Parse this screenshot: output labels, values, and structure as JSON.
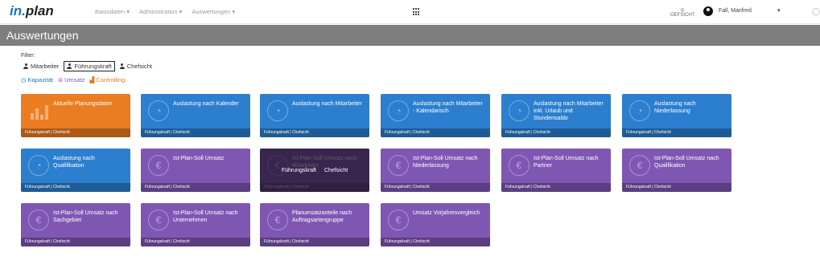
{
  "app": {
    "logo_part1": "in.",
    "logo_part2": "plan"
  },
  "nav": [
    "Basisdaten ▾",
    "Administration ▾",
    "Auswertungen ▾"
  ],
  "brand": {
    "line1": "◎",
    "line2": "OEFSICHT"
  },
  "user": {
    "name": "Fall, Manfred",
    "caret": "▾"
  },
  "page": {
    "title": "Auswertungen"
  },
  "filter": {
    "label": "Filter:",
    "roles": [
      {
        "label": "Mitarbeiter",
        "active": false
      },
      {
        "label": "Führungskraft",
        "active": true
      },
      {
        "label": "Chefsicht",
        "active": false
      }
    ],
    "categories": [
      {
        "label": "Kapazität",
        "icon": "clock-icon",
        "color": "#1a73c8"
      },
      {
        "label": "Umsatz",
        "icon": "euro-icon",
        "color": "#8b4fb3"
      },
      {
        "label": "Controlling",
        "icon": "bar-chart-icon",
        "color": "#e07b20"
      }
    ]
  },
  "tiles": [
    {
      "title": "Aktuelle Planungsdaten",
      "color": "orange",
      "icon": "bar-chart-icon",
      "footer": "Führungskraft | Chefsicht"
    },
    {
      "title": "Auslastung nach Kalender",
      "color": "blue",
      "icon": "gauge-icon",
      "footer": "Führungskraft | Chefsicht"
    },
    {
      "title": "Auslastung nach Mitarbeiter",
      "color": "blue",
      "icon": "gauge-icon",
      "footer": "Führungskraft | Chefsicht"
    },
    {
      "title": "Auslastung nach Mitarbeiter - Kalendarisch",
      "color": "blue",
      "icon": "gauge-icon",
      "footer": "Führungskraft | Chefsicht"
    },
    {
      "title": "Auslastung nach Mitarbeiter inkl. Urlaub und Stundensaldo",
      "color": "blue",
      "icon": "gauge-icon",
      "footer": "Führungskraft | Chefsicht"
    },
    {
      "title": "Auslastung nach Niederlassung",
      "color": "blue",
      "icon": "gauge-icon",
      "footer": "Führungskraft | Chefsicht"
    },
    {
      "title": "Auslastung nach Qualifikation",
      "color": "blue",
      "icon": "gauge-icon",
      "footer": "Führungskraft | Chefsicht"
    },
    {
      "title": "Ist-Plan-Soll Umsatz",
      "color": "purple",
      "icon": "euro-icon",
      "footer": "Führungskraft | Chefsicht"
    },
    {
      "title": "Ist-Plan-Soll Umsatz nach Mitarbeiter",
      "color": "purple",
      "icon": "euro-icon",
      "footer": "Führungskraft | Chefsicht",
      "overlay": {
        "left": "Führungskraft",
        "right": "Chefsicht"
      }
    },
    {
      "title": "Ist-Plan-Soll Umsatz nach Niederlassung",
      "color": "purple",
      "icon": "euro-icon",
      "footer": "Führungskraft | Chefsicht"
    },
    {
      "title": "Ist-Plan-Soll Umsatz nach Partner",
      "color": "purple",
      "icon": "euro-icon",
      "footer": "Führungskraft | Chefsicht"
    },
    {
      "title": "Ist-Plan-Soll Umsatz nach Qualifikation",
      "color": "purple",
      "icon": "euro-icon",
      "footer": "Führungskraft | Chefsicht"
    },
    {
      "title": "Ist-Plan-Soll Umsatz nach Sachgebiet",
      "color": "purple",
      "icon": "euro-icon",
      "footer": "Führungskraft | Chefsicht"
    },
    {
      "title": "Ist-Plan-Soll Umsatz nach Unternehmen",
      "color": "purple",
      "icon": "euro-icon",
      "footer": "Führungskraft | Chefsicht"
    },
    {
      "title": "Planumsatzanteile nach Auftragsartengruppe",
      "color": "purple",
      "icon": "euro-icon",
      "footer": "Führungskraft | Chefsicht"
    },
    {
      "title": "Umsatz Vorjahresvergleich",
      "color": "purple",
      "icon": "euro-icon",
      "footer": "Führungskraft | Chefsicht"
    }
  ]
}
